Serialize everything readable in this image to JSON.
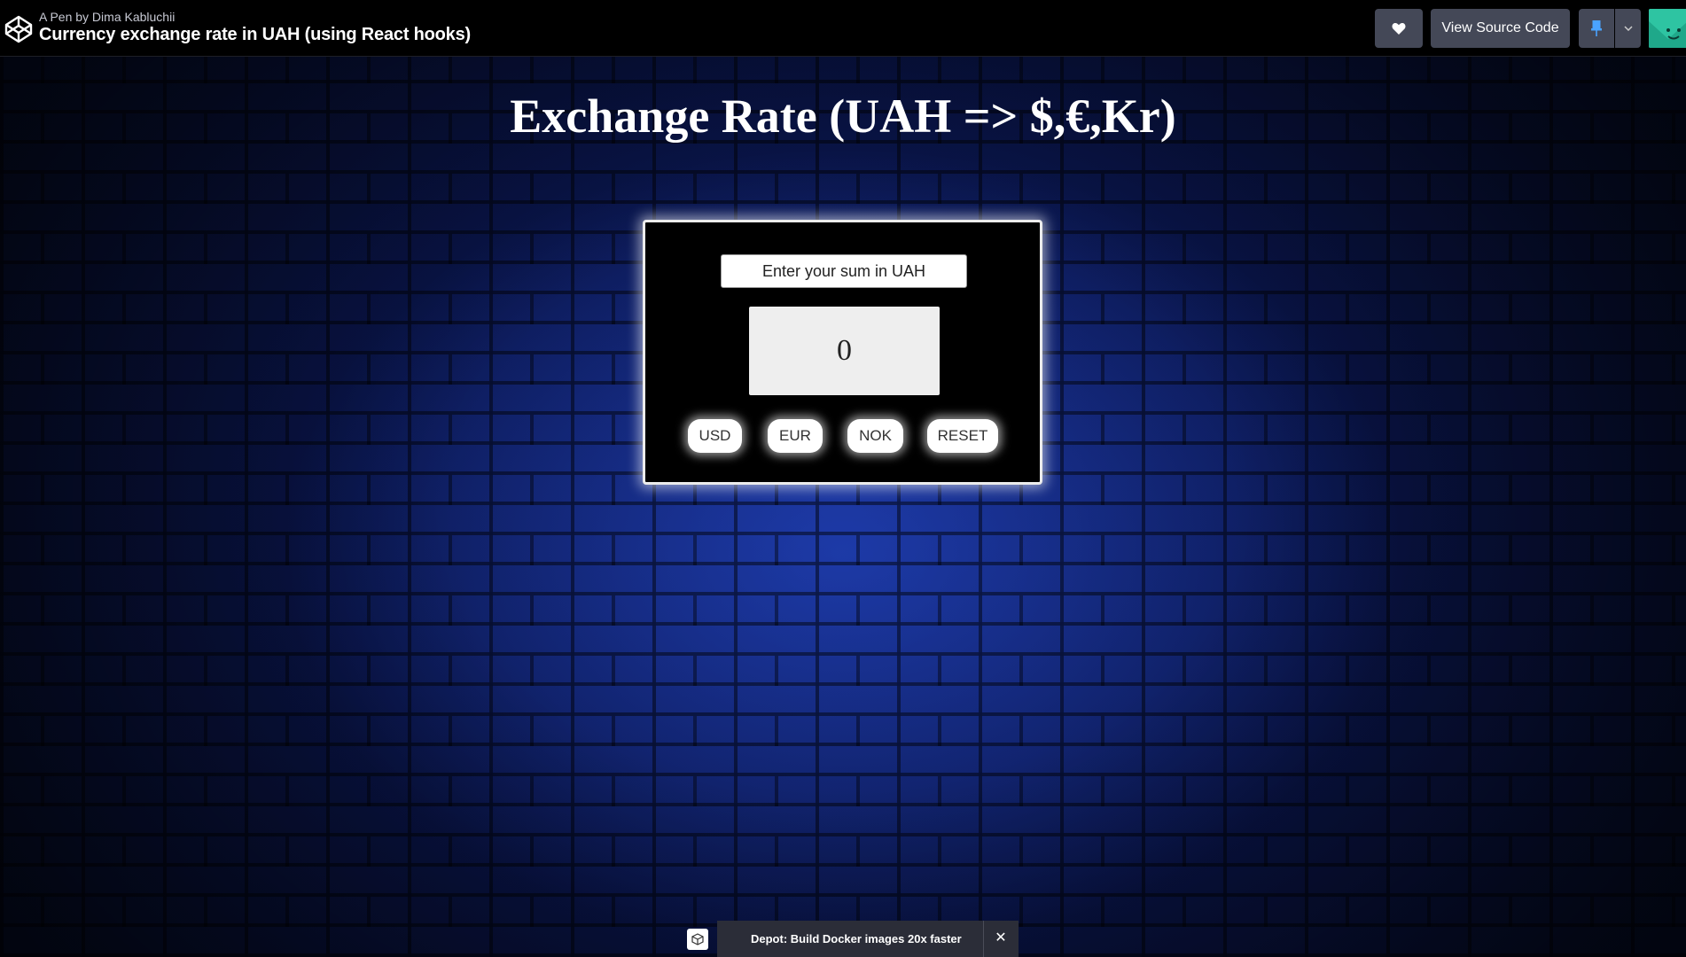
{
  "topbar": {
    "author": "A Pen by Dima Kabluchii",
    "title": "Currency exchange rate in UAH (using React hooks)",
    "view_source_label": "View Source Code"
  },
  "app": {
    "heading": "Exchange Rate (UAH => $,€,Kr)",
    "input_label": "Enter your sum in UAH",
    "amount_value": "0",
    "buttons": [
      "USD",
      "EUR",
      "NOK",
      "RESET"
    ]
  },
  "ad": {
    "text": "Depot: Build Docker images 20x faster",
    "close": "✕"
  },
  "colors": {
    "topbar_bg": "#000000",
    "button_bg": "#444857",
    "pin_accent": "#47cf73",
    "avatar_bg": "#2ec4a2"
  },
  "icons": [
    "codepen-logo-icon",
    "heart-icon",
    "pin-icon",
    "chevron-down-icon",
    "docker-icon",
    "close-icon"
  ]
}
